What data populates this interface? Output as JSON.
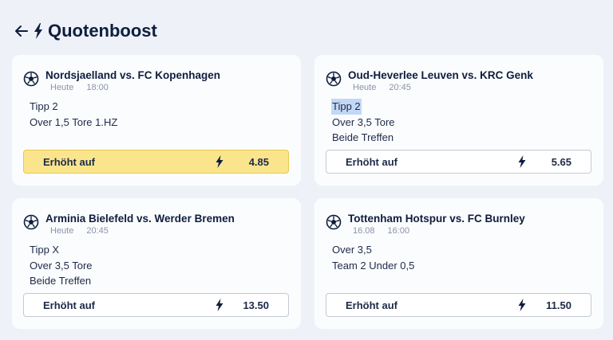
{
  "header": {
    "title": "Quotenboost",
    "back_icon": "arrow-left-icon",
    "bolt_icon": "lightning-bolt-icon"
  },
  "colors": {
    "background": "#eef2f8",
    "card": "#fbfcfe",
    "text": "#0f1d3d",
    "active_boost": "#fae58d",
    "highlight": "#c3d8f5"
  },
  "cards": [
    {
      "match": "Nordsjaelland vs. FC Kopenhagen",
      "day": "Heute",
      "time": "18:00",
      "selections": [
        "Tipp 2",
        "Over 1,5 Tore 1.HZ"
      ],
      "boost_label": "Erhöht auf",
      "odds": "4.85",
      "active": true
    },
    {
      "match": "Oud-Heverlee Leuven vs. KRC Genk",
      "day": "Heute",
      "time": "20:45",
      "selections": [
        "Tipp 2",
        "Over 3,5 Tore",
        "Beide Treffen"
      ],
      "boost_label": "Erhöht auf",
      "odds": "5.65",
      "active": false
    },
    {
      "match": "Arminia Bielefeld vs. Werder Bremen",
      "day": "Heute",
      "time": "20:45",
      "selections": [
        "Tipp X",
        "Over 3,5 Tore",
        "Beide Treffen"
      ],
      "boost_label": "Erhöht auf",
      "odds": "13.50",
      "active": false
    },
    {
      "match": "Tottenham Hotspur vs. FC Burnley",
      "day": "16.08",
      "time": "16:00",
      "selections": [
        "Over 3,5",
        "Team 2 Under 0,5"
      ],
      "boost_label": "Erhöht auf",
      "odds": "11.50",
      "active": false
    }
  ]
}
